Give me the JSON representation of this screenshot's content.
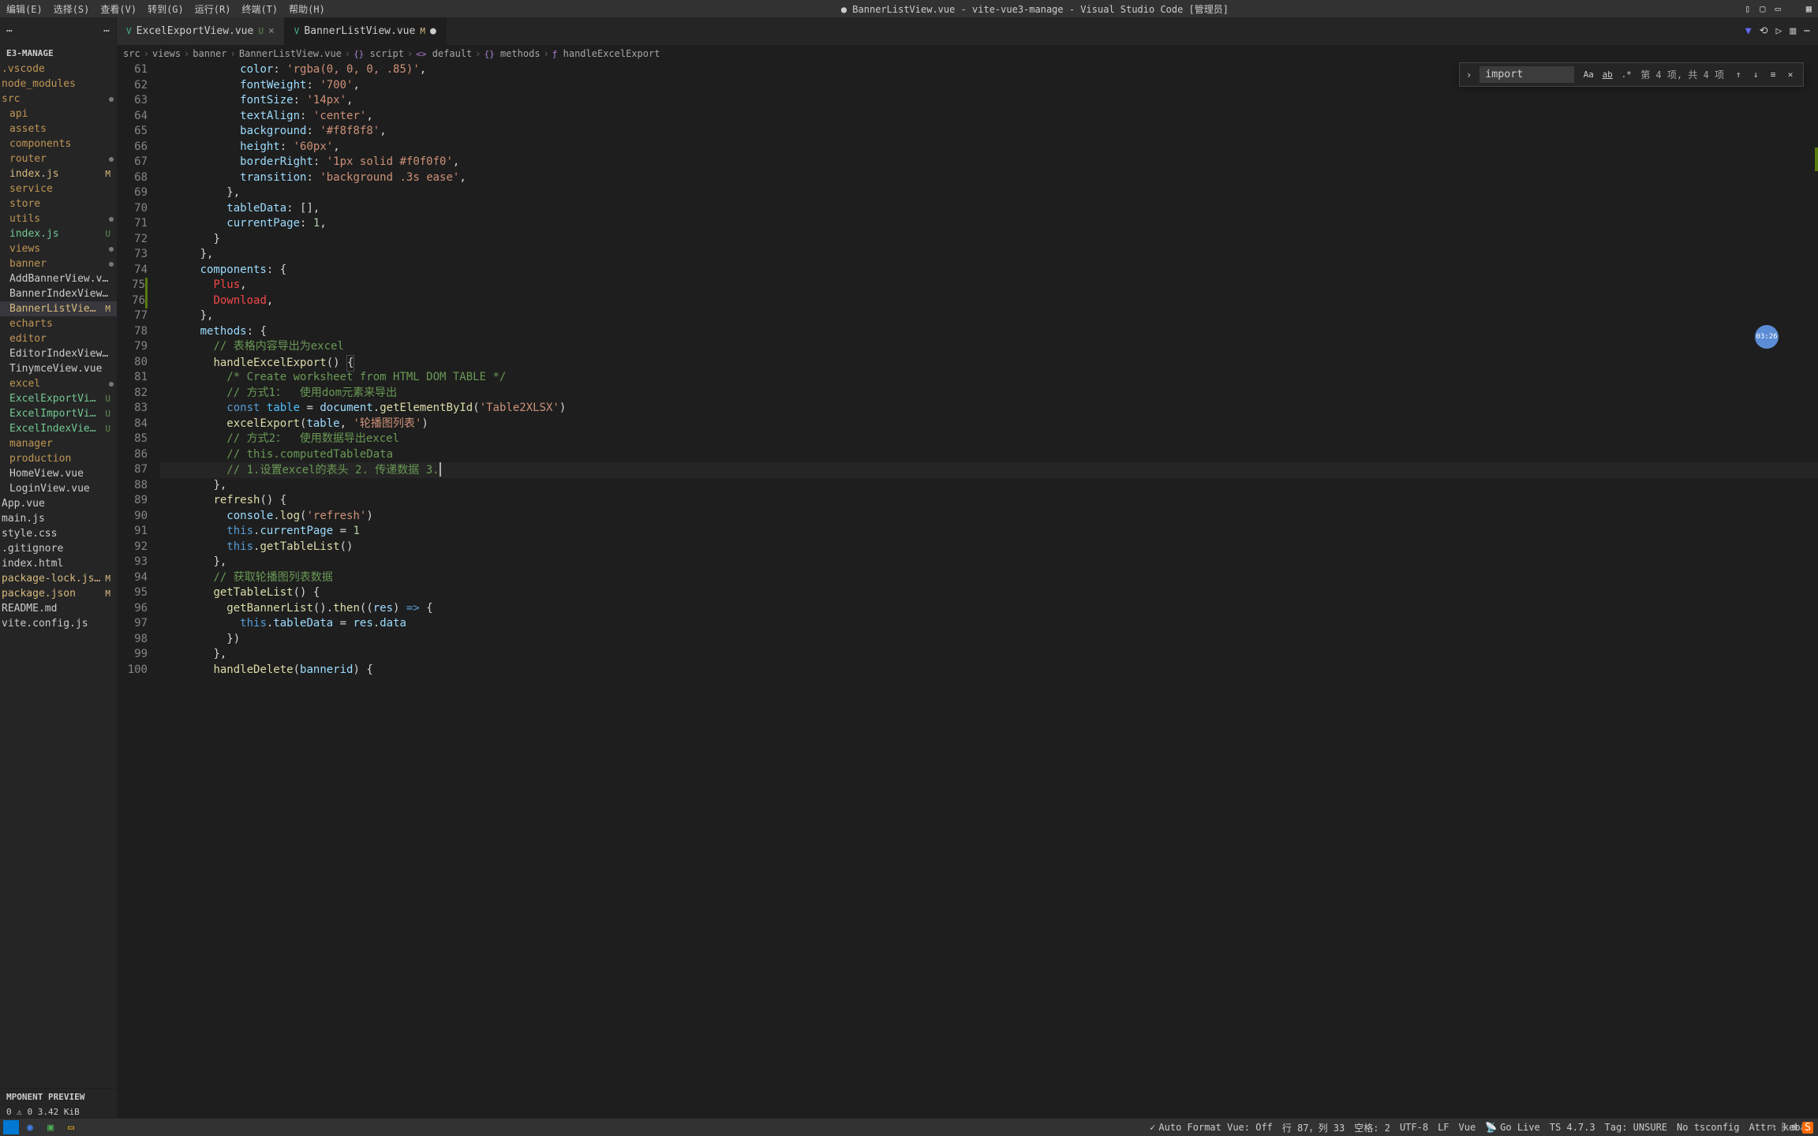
{
  "titlebar": {
    "menus": [
      "编辑(E)",
      "选择(S)",
      "查看(V)",
      "转到(G)",
      "运行(R)",
      "终端(T)",
      "帮助(H)"
    ],
    "title": "● BannerListView.vue - vite-vue3-manage - Visual Studio Code [管理员]"
  },
  "sidebar": {
    "projectName": "E3-MANAGE",
    "items": [
      {
        "label": ".vscode",
        "type": "folder",
        "indent": 0
      },
      {
        "label": "node_modules",
        "type": "folder",
        "indent": 0
      },
      {
        "label": "src",
        "type": "folder",
        "indent": 0,
        "dot": true
      },
      {
        "label": "api",
        "type": "folder",
        "indent": 1
      },
      {
        "label": "assets",
        "type": "folder",
        "indent": 1
      },
      {
        "label": "components",
        "type": "folder",
        "indent": 1
      },
      {
        "label": "router",
        "type": "folder",
        "indent": 1,
        "dot": true
      },
      {
        "label": "index.js",
        "type": "file",
        "indent": 1,
        "badge": "M",
        "color": "file-M"
      },
      {
        "label": "service",
        "type": "folder",
        "indent": 1
      },
      {
        "label": "store",
        "type": "folder",
        "indent": 1
      },
      {
        "label": "utils",
        "type": "folder",
        "indent": 1,
        "dot": true
      },
      {
        "label": "index.js",
        "type": "file",
        "indent": 1,
        "badge": "U",
        "color": "file-U"
      },
      {
        "label": "views",
        "type": "folder",
        "indent": 1,
        "dot": true
      },
      {
        "label": "banner",
        "type": "folder",
        "indent": 1,
        "dot": true
      },
      {
        "label": "AddBannerView.vue",
        "type": "file",
        "indent": 1
      },
      {
        "label": "BannerIndexView.vue",
        "type": "file",
        "indent": 1
      },
      {
        "label": "BannerListView.vue",
        "type": "file",
        "indent": 1,
        "badge": "M",
        "selected": true,
        "color": "file-M"
      },
      {
        "label": "echarts",
        "type": "folder",
        "indent": 1
      },
      {
        "label": "editor",
        "type": "folder",
        "indent": 1
      },
      {
        "label": "EditorIndexView.vue",
        "type": "file",
        "indent": 1
      },
      {
        "label": "TinymceView.vue",
        "type": "file",
        "indent": 1
      },
      {
        "label": "excel",
        "type": "folder",
        "indent": 1,
        "dot": true
      },
      {
        "label": "ExcelExportView.vue",
        "type": "file",
        "indent": 1,
        "badge": "U",
        "color": "file-U"
      },
      {
        "label": "ExcelImportView.vue",
        "type": "file",
        "indent": 1,
        "badge": "U",
        "color": "file-U"
      },
      {
        "label": "ExcelIndexView.vue",
        "type": "file",
        "indent": 1,
        "badge": "U",
        "color": "file-U"
      },
      {
        "label": "manager",
        "type": "folder",
        "indent": 1
      },
      {
        "label": "production",
        "type": "folder",
        "indent": 1
      },
      {
        "label": "HomeView.vue",
        "type": "file",
        "indent": 1
      },
      {
        "label": "LoginView.vue",
        "type": "file",
        "indent": 1
      },
      {
        "label": "App.vue",
        "type": "file",
        "indent": 0
      },
      {
        "label": "main.js",
        "type": "file",
        "indent": 0
      },
      {
        "label": "style.css",
        "type": "file",
        "indent": 0
      },
      {
        "label": ".gitignore",
        "type": "file",
        "indent": 0
      },
      {
        "label": "index.html",
        "type": "file",
        "indent": 0
      },
      {
        "label": "package-lock.json",
        "type": "file",
        "indent": 0,
        "badge": "M",
        "color": "file-M"
      },
      {
        "label": "package.json",
        "type": "file",
        "indent": 0,
        "badge": "M",
        "color": "file-M"
      },
      {
        "label": "README.md",
        "type": "file",
        "indent": 0
      },
      {
        "label": "vite.config.js",
        "type": "file",
        "indent": 0
      }
    ],
    "componentPreview": "MPONENT PREVIEW",
    "memInfo": "0 ⚠ 0   3.42 KiB"
  },
  "tabs": [
    {
      "label": "ExcelExportView.vue",
      "status": "U",
      "active": false
    },
    {
      "label": "BannerListView.vue",
      "status": "M",
      "active": true,
      "dirty": true
    }
  ],
  "breadcrumb": [
    "src",
    "views",
    "banner",
    "BannerListView.vue",
    "script",
    "default",
    "methods",
    "handleExcelExport"
  ],
  "find": {
    "value": "import",
    "count": "第 4 项, 共 4 项"
  },
  "code": {
    "startLine": 61,
    "lines": [
      {
        "n": 61,
        "html": "            <span class='tok-key'>color</span><span class='tok-punc'>:</span> <span class='tok-str'>'rgba(0, 0, 0, .85)'</span><span class='tok-punc'>,</span>"
      },
      {
        "n": 62,
        "html": "            <span class='tok-key'>fontWeight</span><span class='tok-punc'>:</span> <span class='tok-str'>'700'</span><span class='tok-punc'>,</span>"
      },
      {
        "n": 63,
        "html": "            <span class='tok-key'>fontSize</span><span class='tok-punc'>:</span> <span class='tok-str'>'14px'</span><span class='tok-punc'>,</span>"
      },
      {
        "n": 64,
        "html": "            <span class='tok-key'>textAlign</span><span class='tok-punc'>:</span> <span class='tok-str'>'center'</span><span class='tok-punc'>,</span>"
      },
      {
        "n": 65,
        "html": "            <span class='tok-key'>background</span><span class='tok-punc'>:</span> <span class='tok-str'>'#f8f8f8'</span><span class='tok-punc'>,</span>"
      },
      {
        "n": 66,
        "html": "            <span class='tok-key'>height</span><span class='tok-punc'>:</span> <span class='tok-str'>'60px'</span><span class='tok-punc'>,</span>"
      },
      {
        "n": 67,
        "html": "            <span class='tok-key'>borderRight</span><span class='tok-punc'>:</span> <span class='tok-str'>'1px solid #f0f0f0'</span><span class='tok-punc'>,</span>"
      },
      {
        "n": 68,
        "html": "            <span class='tok-key'>transition</span><span class='tok-punc'>:</span> <span class='tok-str'>'background .3s ease'</span><span class='tok-punc'>,</span>"
      },
      {
        "n": 69,
        "html": "          <span class='tok-punc'>},</span>"
      },
      {
        "n": 70,
        "html": "          <span class='tok-key'>tableData</span><span class='tok-punc'>:</span> <span class='tok-punc'>[],</span>"
      },
      {
        "n": 71,
        "html": "          <span class='tok-key'>currentPage</span><span class='tok-punc'>:</span> <span class='tok-num'>1</span><span class='tok-punc'>,</span>"
      },
      {
        "n": 72,
        "html": "        <span class='tok-punc'>}</span>"
      },
      {
        "n": 73,
        "html": "      <span class='tok-punc'>},</span>"
      },
      {
        "n": 74,
        "html": "      <span class='tok-key'>components</span><span class='tok-punc'>:</span> <span class='tok-punc'>{</span>"
      },
      {
        "n": 75,
        "html": "        <span class='tok-err'>Plus</span><span class='tok-punc'>,</span>",
        "side": "green"
      },
      {
        "n": 76,
        "html": "        <span class='tok-err'>Download</span><span class='tok-punc'>,</span>",
        "side": "green"
      },
      {
        "n": 77,
        "html": "      <span class='tok-punc'>},</span>"
      },
      {
        "n": 78,
        "html": "      <span class='tok-key'>methods</span><span class='tok-punc'>:</span> <span class='tok-punc'>{</span>"
      },
      {
        "n": 79,
        "html": "        <span class='tok-comment'>// 表格内容导出为excel</span>"
      },
      {
        "n": 80,
        "html": "        <span class='tok-fn'>handleExcelExport</span><span class='tok-punc'>()</span> <span class='tok-punc funline'>{</span>"
      },
      {
        "n": 81,
        "html": "          <span class='tok-comment'>/* Create worksheet from HTML DOM TABLE */</span>"
      },
      {
        "n": 82,
        "html": "          <span class='tok-comment'>// 方式1：  使用dom元素来导出</span>"
      },
      {
        "n": 83,
        "html": "          <span class='tok-kw'>const</span> <span class='tok-const'>table</span> <span class='tok-punc'>=</span> <span class='tok-var'>document</span><span class='tok-punc'>.</span><span class='tok-fn'>getElementById</span><span class='tok-punc'>(</span><span class='tok-str'>'Table2XLSX'</span><span class='tok-punc'>)</span>"
      },
      {
        "n": 84,
        "html": "          <span class='tok-fn'>excelExport</span><span class='tok-punc'>(</span><span class='tok-var'>table</span><span class='tok-punc'>,</span> <span class='tok-str'>'轮播图列表'</span><span class='tok-punc'>)</span>"
      },
      {
        "n": 85,
        "html": "          <span class='tok-comment'>// 方式2：  使用数据导出excel</span>"
      },
      {
        "n": 86,
        "html": "          <span class='tok-comment'>// this.computedTableData</span>"
      },
      {
        "n": 87,
        "html": "          <span class='tok-comment'>// 1.设置excel的表头 2. 传递数据 3.</span><span class='cursor-blink'></span>",
        "current": true
      },
      {
        "n": 88,
        "html": "        <span class='tok-punc'>},</span>"
      },
      {
        "n": 89,
        "html": "        <span class='tok-fn'>refresh</span><span class='tok-punc'>()</span> <span class='tok-punc'>{</span>"
      },
      {
        "n": 90,
        "html": "          <span class='tok-var'>console</span><span class='tok-punc'>.</span><span class='tok-fn'>log</span><span class='tok-punc'>(</span><span class='tok-str'>'refresh'</span><span class='tok-punc'>)</span>"
      },
      {
        "n": 91,
        "html": "          <span class='tok-kw'>this</span><span class='tok-punc'>.</span><span class='tok-var'>currentPage</span> <span class='tok-punc'>=</span> <span class='tok-num'>1</span>"
      },
      {
        "n": 92,
        "html": "          <span class='tok-kw'>this</span><span class='tok-punc'>.</span><span class='tok-fn'>getTableList</span><span class='tok-punc'>()</span>"
      },
      {
        "n": 93,
        "html": "        <span class='tok-punc'>},</span>"
      },
      {
        "n": 94,
        "html": "        <span class='tok-comment'>// 获取轮播图列表数据</span>"
      },
      {
        "n": 95,
        "html": "        <span class='tok-fn'>getTableList</span><span class='tok-punc'>()</span> <span class='tok-punc'>{</span>"
      },
      {
        "n": 96,
        "html": "          <span class='tok-fn'>getBannerList</span><span class='tok-punc'>().</span><span class='tok-fn'>then</span><span class='tok-punc'>((</span><span class='tok-var'>res</span><span class='tok-punc'>)</span> <span class='tok-kw'>=></span> <span class='tok-punc'>{</span>"
      },
      {
        "n": 97,
        "html": "            <span class='tok-kw'>this</span><span class='tok-punc'>.</span><span class='tok-var'>tableData</span> <span class='tok-punc'>=</span> <span class='tok-var'>res</span><span class='tok-punc'>.</span><span class='tok-var'>data</span>"
      },
      {
        "n": 98,
        "html": "          <span class='tok-punc'>})</span>"
      },
      {
        "n": 99,
        "html": "        <span class='tok-punc'>},</span>"
      },
      {
        "n": 100,
        "html": "        <span class='tok-fn'>handleDelete</span><span class='tok-punc'>(</span><span class='tok-var'>bannerid</span><span class='tok-punc'>)</span> <span class='tok-punc'>{</span>"
      }
    ]
  },
  "statusbar": {
    "autoFormat": "Auto Format Vue: Off",
    "cursor": "行 87，列 33",
    "spaces": "空格: 2",
    "encoding": "UTF-8",
    "eol": "LF",
    "lang": "Vue",
    "golive": "Go Live",
    "ts": "TS 4.7.3",
    "tag": "Tag: UNSURE",
    "tsconfig": "No tsconfig",
    "attr": "Attr: kebab"
  },
  "timer": "03:26"
}
